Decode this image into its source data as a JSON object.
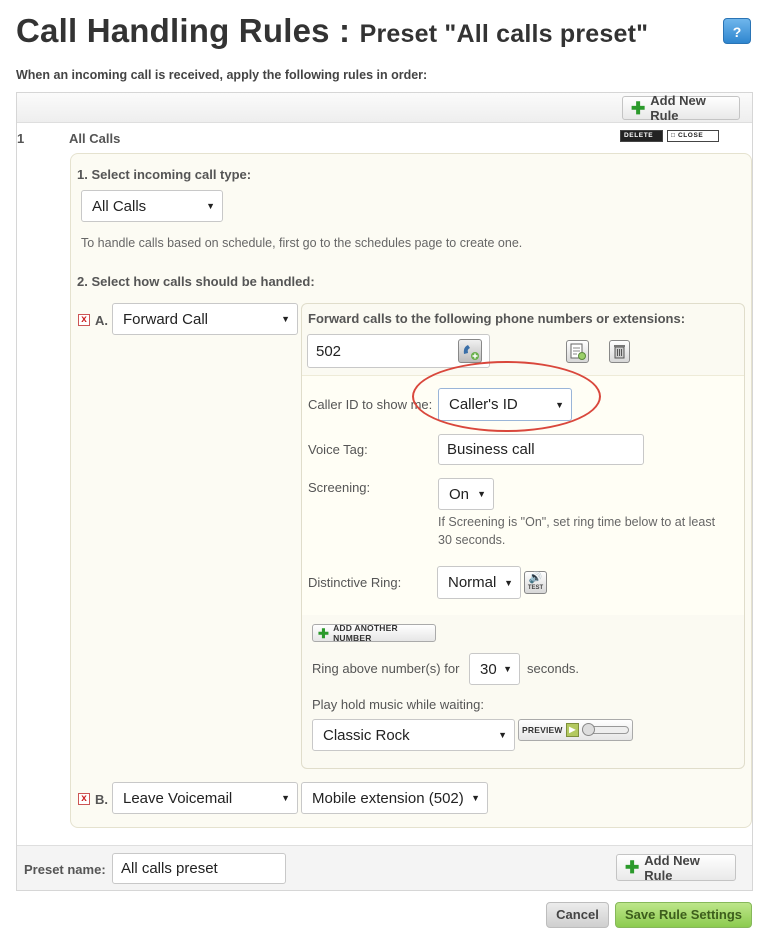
{
  "header": {
    "title": "Call Handling Rules : ",
    "subtitle": "Preset \"All calls preset\"",
    "help_label": "?",
    "intro": "When an incoming call is received, apply the following rules in order:"
  },
  "toolbar": {
    "add_rule_label": "Add New Rule"
  },
  "rule": {
    "number": "1",
    "name": "All Calls",
    "delete_label": "DELETE",
    "close_label": "CLOSE",
    "step1_label": "1. Select incoming call type:",
    "call_type": "All Calls",
    "schedule_note": "To handle calls based on schedule, first go to the schedules page to create one.",
    "step2_label": "2. Select how calls should be handled:"
  },
  "action_a": {
    "x": "x",
    "letter": "A.",
    "action": "Forward Call",
    "forward_label": "Forward calls to the following phone numbers or extensions:",
    "number": "502",
    "caller_id_label": "Caller ID to show me:",
    "caller_id": "Caller's ID",
    "voice_tag_label": "Voice Tag:",
    "voice_tag": "Business call",
    "screening_label": "Screening:",
    "screening": "On",
    "screening_note": "If Screening is \"On\", set ring time below to at least 30 seconds.",
    "ring_label": "Distinctive Ring:",
    "ring": "Normal",
    "test_label": "TEST",
    "add_number_label": "ADD ANOTHER NUMBER",
    "ring_above_label": "Ring above number(s) for",
    "ring_seconds": "30",
    "seconds_label": "seconds.",
    "hold_music_label": "Play hold music while waiting:",
    "hold_music": "Classic Rock",
    "preview_label": "PREVIEW"
  },
  "action_b": {
    "x": "x",
    "letter": "B.",
    "action": "Leave Voicemail",
    "target": "Mobile extension (502)"
  },
  "footer": {
    "preset_label": "Preset name:",
    "preset_name": "All calls preset",
    "add_rule_label": "Add New Rule"
  },
  "actions": {
    "cancel_label": "Cancel",
    "save_label": "Save Rule Settings"
  }
}
